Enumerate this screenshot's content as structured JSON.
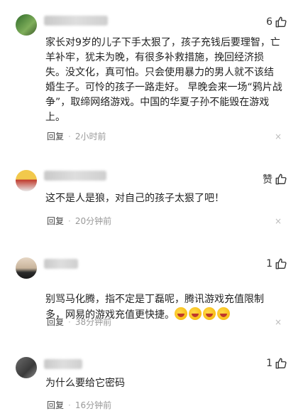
{
  "comments": [
    {
      "likes": "6",
      "text": "家长对9岁的儿子下手太狠了，孩子充钱后要理智，亡\n羊补牢，犹未为晚，有很多补救措施，挽回经济损\n失。没文化，真可怕。只会使用暴力的男人就不该结\n婚生子。可怜的孩子一路走好。 早晚会来一场“鸦片战\n争”，取缔网络游戏。中国的华夏子孙不能毁在游戏\n上。",
      "reply_label": "回复",
      "time": "2小时前"
    },
    {
      "likes": "赞",
      "text": "这不是人是狼，对自己的孩子太狠了吧！",
      "reply_label": "回复",
      "time": "20分钟前"
    },
    {
      "likes": "1",
      "text": "别骂马化腾，指不定是丁磊呢，腾讯游戏充值限制\n多，网易的游戏充值更快捷。",
      "emoji_count": 4,
      "reply_label": "回复",
      "time": "38分钟前"
    },
    {
      "likes": "1",
      "text": "为什么要给它密码",
      "reply_label": "回复",
      "time": "16分钟前"
    }
  ],
  "close_symbol": "×",
  "dot_symbol": "·",
  "icons": {
    "like": "thumbs-up-icon",
    "close": "close-icon",
    "emoji": "laughing-emoji-icon"
  }
}
